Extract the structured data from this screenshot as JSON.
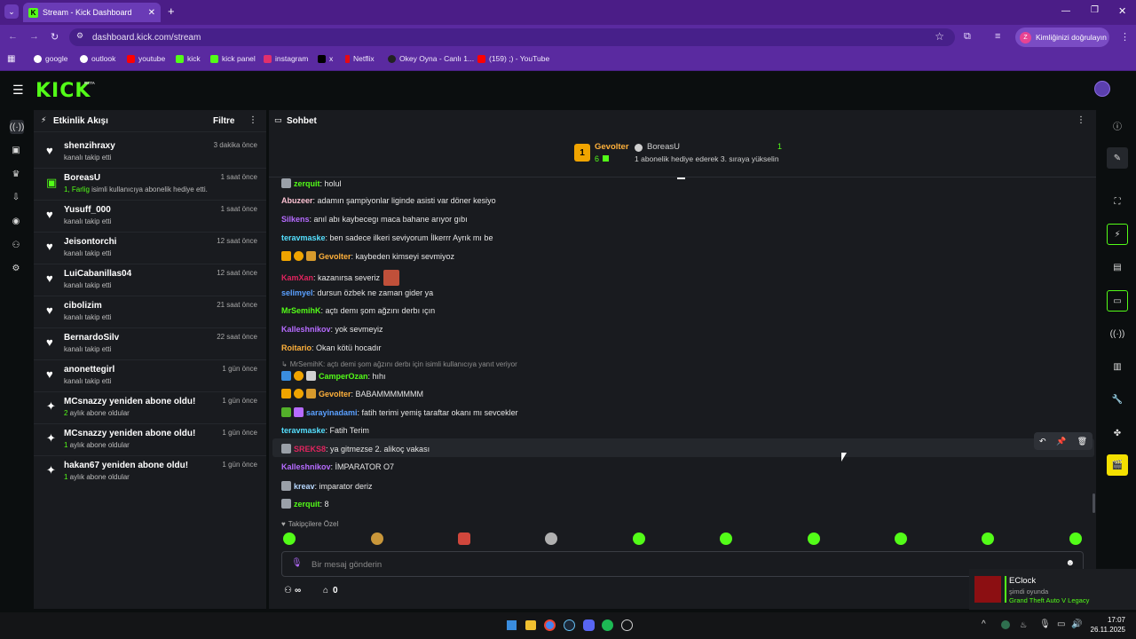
{
  "browser": {
    "tab_title": "Stream - Kick Dashboard",
    "url": "dashboard.kick.com/stream",
    "profile_label": "Kimliğinizi doğrulayın",
    "profile_initial": "Z",
    "bookmarks": [
      {
        "label": "google",
        "color": "#ffffff"
      },
      {
        "label": "outlook",
        "color": "#ffffff"
      },
      {
        "label": "youtube",
        "color": "#ff0000"
      },
      {
        "label": "kick",
        "color": "#53fc18"
      },
      {
        "label": "kick panel",
        "color": "#53fc18"
      },
      {
        "label": "instagram",
        "color": "#e1306c"
      },
      {
        "label": "x",
        "color": "#000000"
      },
      {
        "label": "Netflix",
        "color": "#e50914"
      },
      {
        "label": "Okey Oyna - Canlı 1...",
        "color": "#222222"
      },
      {
        "label": "(159) ;) - YouTube",
        "color": "#ff0000"
      }
    ]
  },
  "kick": {
    "logo": "KICK",
    "beta": "BETA"
  },
  "activity": {
    "title": "Etkinlik Akışı",
    "filter": "Filtre",
    "items": [
      {
        "name": "shenzihraxy",
        "sub": "kanalı takip etti",
        "time": "3 dakika önce",
        "icon": "heart-icon"
      },
      {
        "name": "BoreasU",
        "sub_highlight": "1, Farlig",
        "sub": " isimli kullanıcıya abonelik hediye etti.",
        "time": "1 saat önce",
        "icon": "gift-icon"
      },
      {
        "name": "Yusuff_000",
        "sub": "kanalı takip etti",
        "time": "1 saat önce",
        "icon": "heart-icon"
      },
      {
        "name": "Jeisontorchi",
        "sub": "kanalı takip etti",
        "time": "12 saat önce",
        "icon": "heart-icon"
      },
      {
        "name": "LuiCabanillas04",
        "sub": "kanalı takip etti",
        "time": "12 saat önce",
        "icon": "heart-icon"
      },
      {
        "name": "cibolizim",
        "sub": "kanalı takip etti",
        "time": "21 saat önce",
        "icon": "heart-icon"
      },
      {
        "name": "BernardoSilv",
        "sub": "kanalı takip etti",
        "time": "22 saat önce",
        "icon": "heart-icon"
      },
      {
        "name": "anonettegirl",
        "sub": "kanalı takip etti",
        "time": "1 gün önce",
        "icon": "heart-icon"
      },
      {
        "name": "MCsnazzy yeniden abone oldu!",
        "sub_highlight": "2",
        "sub": " aylık abone oldular",
        "time": "1 gün önce",
        "icon": "sparkle-icon"
      },
      {
        "name": "MCsnazzy yeniden abone oldu!",
        "sub_highlight": "1",
        "sub": " aylık abone oldular",
        "time": "1 gün önce",
        "icon": "sparkle-icon"
      },
      {
        "name": "hakan67 yeniden abone oldu!",
        "sub_highlight": "1",
        "sub": " aylık abone oldular",
        "time": "1 gün önce",
        "icon": "sparkle-icon"
      }
    ]
  },
  "chat": {
    "title": "Sohbet",
    "top_gifter": {
      "name": "Gevolter",
      "count": "6",
      "rank": "1"
    },
    "gift_event": {
      "name": "BoreasU",
      "count": "1",
      "text": "1 abonelik hediye ederek 3. sıraya yükselin"
    },
    "reply_context": "MrSemihK: açtı demi şom ağzını derbı için isimli kullanıcıya yanıt veriyor",
    "messages": [
      {
        "user": "zerquit",
        "color": "#53fc18",
        "text": ": holul"
      },
      {
        "user": "Abuzeer",
        "color": "#f9c0d0",
        "text": ": adamın şampiyonlar liginde asisti var döner kesiyo"
      },
      {
        "user": "Silkens",
        "color": "#b66bff",
        "text": ": anıl abı kaybecegı maca bahane arıyor gıbı"
      },
      {
        "user": "teravmaske",
        "color": "#55e0ff",
        "text": ": ben sadece ilkeri seviyorum İlkerrr Ayrık mı be"
      },
      {
        "user": "Gevolter",
        "color": "#ffb13b",
        "text": ": kaybeden kimseyi sevmiyoz"
      },
      {
        "user": "KamXan",
        "color": "#e0245e",
        "text": ": kazanırsa severiz"
      },
      {
        "user": "selimyel",
        "color": "#5aa0ff",
        "text": ": dursun özbek ne zaman gider ya"
      },
      {
        "user": "MrSemihK",
        "color": "#53fc18",
        "text": ": açtı demı şom ağzını derbı ıçın"
      },
      {
        "user": "Kalleshnikov",
        "color": "#b66bff",
        "text": ": yok sevmeyiz"
      },
      {
        "user": "Roitario",
        "color": "#ffb13b",
        "text": ": Okan kötü hocadır"
      },
      {
        "user": "CamperOzan",
        "color": "#53fc18",
        "text": ": hıhı"
      },
      {
        "user": "Gevolter",
        "color": "#ffb13b",
        "text": ": BABAMMMMMMM"
      },
      {
        "user": "sarayinadami",
        "color": "#5aa0ff",
        "text": ": fatih terimi yemiş taraftar okanı mı sevcekler"
      },
      {
        "user": "teravmaske",
        "color": "#55e0ff",
        "text": ": Fatih Terim"
      },
      {
        "user": "SREKS8",
        "color": "#e0245e",
        "text": ": ya gitmezse 2. alikoç vakası"
      },
      {
        "user": "Kalleshnikov",
        "color": "#b66bff",
        "text": ": İMPARATOR O7"
      },
      {
        "user": "kreav",
        "color": "#b8d8ff",
        "text": ": imparator deriz"
      },
      {
        "user": "zerquit",
        "color": "#53fc18",
        "text": ": 8"
      }
    ],
    "emote_label": "Takipçilere Özel",
    "input_placeholder": "Bir mesaj gönderin",
    "viewers_value": "∞",
    "store_value": "0"
  },
  "notification": {
    "title": "EClock",
    "status": "şimdi oyunda",
    "game": "Grand Theft Auto V Legacy"
  },
  "taskbar": {
    "time": "17:07",
    "date": "26.11.2025"
  }
}
